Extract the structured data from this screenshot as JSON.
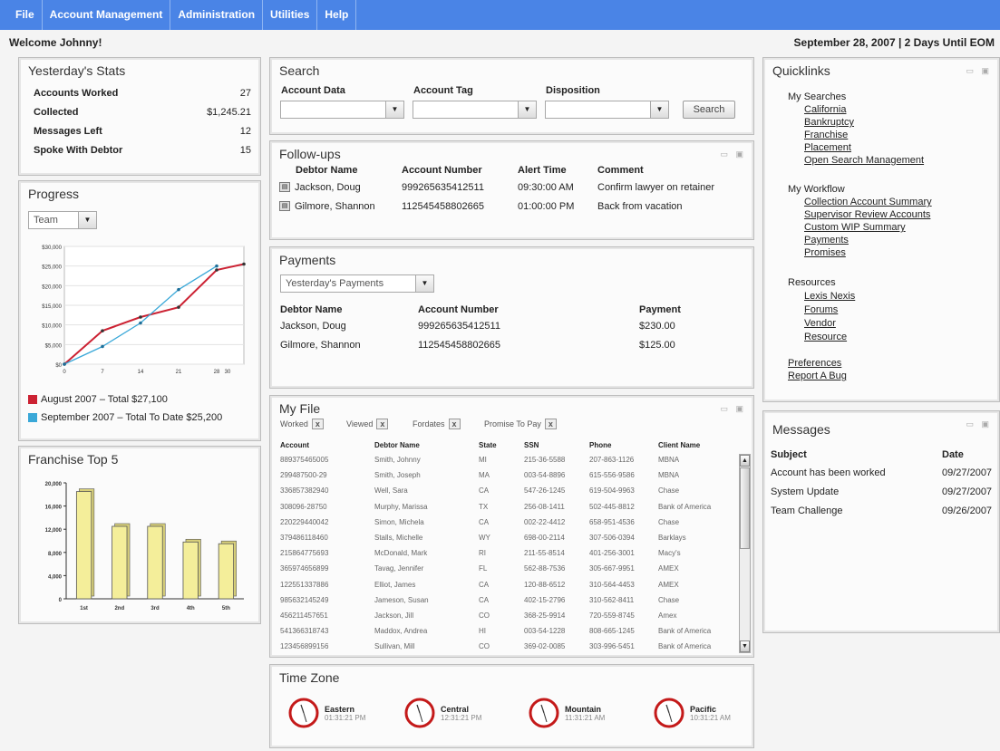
{
  "menu": [
    "File",
    "Account Management",
    "Administration",
    "Utilities",
    "Help"
  ],
  "welcome": "Welcome Johnny!",
  "date_status": "September 28, 2007 | 2 Days Until EOM",
  "stats": {
    "title": "Yesterday's Stats",
    "rows": [
      {
        "label": "Accounts Worked",
        "value": "27"
      },
      {
        "label": "Collected",
        "value": "$1,245.21"
      },
      {
        "label": "Messages Left",
        "value": "12"
      },
      {
        "label": "Spoke With Debtor",
        "value": "15"
      }
    ]
  },
  "progress": {
    "title": "Progress",
    "select": "Team",
    "legend": [
      {
        "text": "August 2007 – Total $27,100",
        "color": "#cc2233"
      },
      {
        "text": "September 2007 – Total To Date $25,200",
        "color": "#3aa8d8"
      }
    ]
  },
  "chart_data": [
    {
      "type": "line",
      "x": [
        0,
        7,
        14,
        21,
        28,
        30
      ],
      "xticks": [
        "0",
        "7",
        "14",
        "21",
        "28",
        "30"
      ],
      "yticks": [
        "$0",
        "$5,000",
        "$10,000",
        "$15,000",
        "$20,000",
        "$25,000",
        "$30,000"
      ],
      "ylim": [
        0,
        30000
      ],
      "series": [
        {
          "name": "August 2007 – Total $27,100",
          "color": "#cc2233",
          "x": [
            0,
            7,
            14,
            21,
            28,
            33
          ],
          "values": [
            0,
            8500,
            12000,
            14500,
            24000,
            25500
          ]
        },
        {
          "name": "September 2007 – Total To Date $25,200",
          "color": "#3aa8d8",
          "x": [
            0,
            7,
            14,
            21,
            28
          ],
          "values": [
            0,
            4500,
            10500,
            19000,
            25000
          ]
        }
      ]
    },
    {
      "type": "bar",
      "categories": [
        "1st",
        "2nd",
        "3rd",
        "4th",
        "5th"
      ],
      "values": [
        18500,
        12500,
        12500,
        9800,
        9500
      ],
      "yticks": [
        "0",
        "2,000",
        "4,000",
        "6,000",
        "8,000",
        "10,000",
        "12,000",
        "14,000",
        "16,000",
        "18,000",
        "20,000"
      ],
      "ylim": [
        0,
        20000
      ],
      "color": "#f4ee9a"
    }
  ],
  "franchise": {
    "title": "Franchise Top 5"
  },
  "search": {
    "title": "Search",
    "fields": [
      "Account Data",
      "Account Tag",
      "Disposition"
    ],
    "button": "Search"
  },
  "followups": {
    "title": "Follow-ups",
    "headers": [
      "Debtor Name",
      "Account Number",
      "Alert Time",
      "Comment"
    ],
    "rows": [
      [
        "Jackson, Doug",
        "999265635412511",
        "09:30:00 AM",
        "Confirm lawyer on retainer"
      ],
      [
        "Gilmore, Shannon",
        "112545458802665",
        "01:00:00 PM",
        "Back from vacation"
      ]
    ]
  },
  "payments": {
    "title": "Payments",
    "select": "Yesterday's Payments",
    "headers": [
      "Debtor Name",
      "Account Number",
      "Payment"
    ],
    "rows": [
      [
        "Jackson, Doug",
        "999265635412511",
        "$230.00"
      ],
      [
        "Gilmore, Shannon",
        "112545458802665",
        "$125.00"
      ]
    ]
  },
  "myfile": {
    "title": "My File",
    "filters": [
      "Worked",
      "Viewed",
      "Fordates",
      "Promise To Pay"
    ],
    "headers": [
      "Account",
      "Debtor Name",
      "State",
      "SSN",
      "Phone",
      "Client Name"
    ],
    "rows": [
      [
        "889375465005",
        "Smith, Johnny",
        "MI",
        "215-36-5588",
        "207-863-1126",
        "MBNA"
      ],
      [
        "299487500-29",
        "Smith, Joseph",
        "MA",
        "003-54-8896",
        "615-556-9586",
        "MBNA"
      ],
      [
        "336857382940",
        "Well, Sara",
        "CA",
        "547-26-1245",
        "619-504-9963",
        "Chase"
      ],
      [
        "308096-28750",
        "Murphy, Marissa",
        "TX",
        "256-08-1411",
        "502-445-8812",
        "Bank of America"
      ],
      [
        "220229440042",
        "Simon, Michela",
        "CA",
        "002-22-4412",
        "658-951-4536",
        "Chase"
      ],
      [
        "379486118460",
        "Stalls, Michelle",
        "WY",
        "698-00-2114",
        "307-506-0394",
        "Barklays"
      ],
      [
        "215864775693",
        "McDonald, Mark",
        "RI",
        "211-55-8514",
        "401-256-3001",
        "Macy's"
      ],
      [
        "365974656899",
        "Tavag, Jennifer",
        "FL",
        "562-88-7536",
        "305-667-9951",
        "AMEX"
      ],
      [
        "122551337886",
        "Elliot, James",
        "CA",
        "120-88-6512",
        "310-564-4453",
        "AMEX"
      ],
      [
        "985632145249",
        "Jameson, Susan",
        "CA",
        "402-15-2796",
        "310-562-8411",
        "Chase"
      ],
      [
        "456211457651",
        "Jackson, Jill",
        "CO",
        "368-25-9914",
        "720-559-8745",
        "Amex"
      ],
      [
        "541366318743",
        "Maddox, Andrea",
        "HI",
        "003-54-1228",
        "808-665-1245",
        "Bank of America"
      ],
      [
        "123456899156",
        "Sullivan, Mill",
        "CO",
        "369-02-0085",
        "303-996-5451",
        "Bank of America"
      ]
    ]
  },
  "timezone": {
    "title": "Time Zone",
    "zones": [
      {
        "name": "Eastern",
        "time": "01:31:21 PM"
      },
      {
        "name": "Central",
        "time": "12:31:21 PM"
      },
      {
        "name": "Mountain",
        "time": "11:31:21 AM"
      },
      {
        "name": "Pacific",
        "time": "10:31:21 AM"
      }
    ]
  },
  "quicklinks": {
    "title": "Quicklinks",
    "groups": [
      {
        "head": "My Searches",
        "links": [
          "California",
          "Bankruptcy",
          "Franchise",
          "Placement",
          "Open Search Management"
        ]
      },
      {
        "head": "My Workflow",
        "links": [
          "Collection Account Summary",
          "Supervisor Review Accounts",
          "Custom WIP Summary",
          "Payments",
          "Promises"
        ]
      },
      {
        "head": "Resources",
        "links": [
          "Lexis Nexis",
          "Forums",
          "Vendor",
          "Resource"
        ]
      }
    ],
    "bottom_links": [
      "Preferences",
      "Report A Bug"
    ]
  },
  "messages": {
    "title": "Messages",
    "headers": [
      "Subject",
      "Date"
    ],
    "rows": [
      [
        "Account has been worked",
        "09/27/2007"
      ],
      [
        "System Update",
        "09/27/2007"
      ],
      [
        "Team Challenge",
        "09/26/2007"
      ]
    ]
  }
}
